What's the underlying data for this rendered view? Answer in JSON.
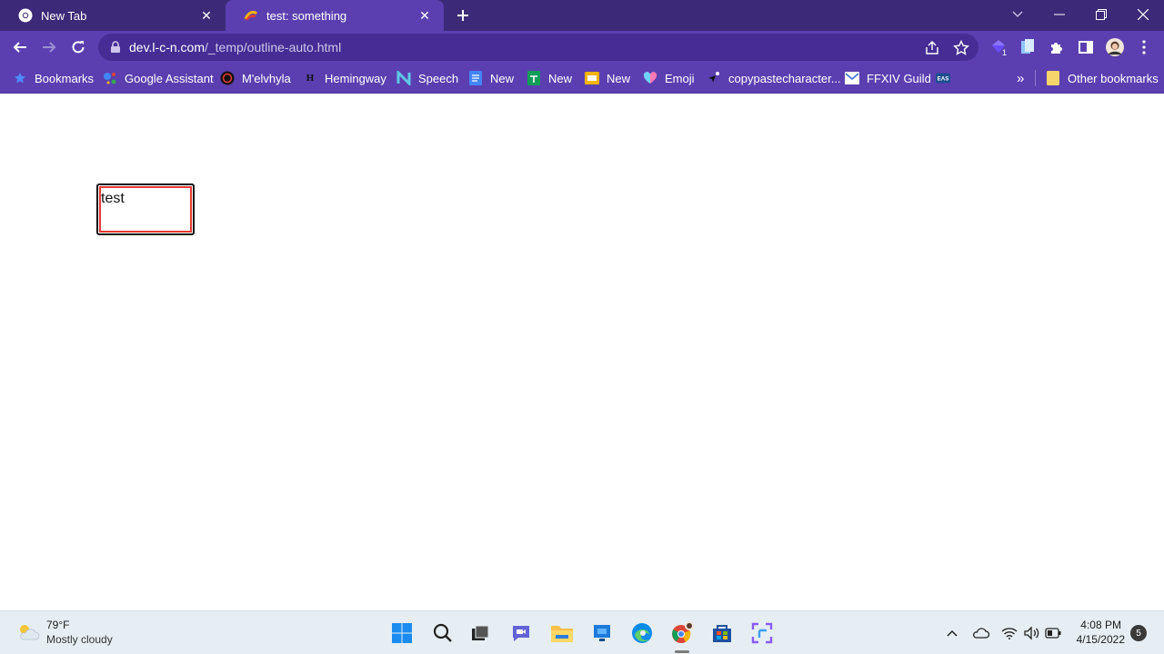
{
  "browser": {
    "tabs": [
      {
        "title": "New Tab",
        "favicon": "chrome-icon",
        "active": false
      },
      {
        "title": "test: something",
        "favicon": "page-favicon",
        "active": true
      }
    ],
    "url_host": "dev.l-c-n.com",
    "url_path": "/_temp/outline-auto.html",
    "extensions_badge": "1"
  },
  "bookmarks": [
    {
      "label": "Bookmarks",
      "icon": "star-icon"
    },
    {
      "label": "Google Assistant",
      "icon": "google-assistant-icon"
    },
    {
      "label": "M'elvhyla",
      "icon": "circle-logo-icon"
    },
    {
      "label": "Hemingway",
      "icon": "hemingway-icon"
    },
    {
      "label": "Speech",
      "icon": "speech-icon"
    },
    {
      "label": "New",
      "icon": "docs-icon"
    },
    {
      "label": "New",
      "icon": "sheets-icon"
    },
    {
      "label": "New",
      "icon": "slides-icon"
    },
    {
      "label": "Emoji",
      "icon": "heart-icon"
    },
    {
      "label": "copypastecharacter...",
      "icon": "cursor-icon"
    },
    {
      "label": "FFXIV Guild",
      "icon": "mail-icon"
    },
    {
      "label": "",
      "icon": "eas-icon"
    }
  ],
  "bookmarks_overflow": "»",
  "other_bookmarks": "Other bookmarks",
  "page": {
    "box_text": "test"
  },
  "taskbar": {
    "weather_temp": "79°F",
    "weather_desc": "Mostly cloudy",
    "time": "4:08 PM",
    "date": "4/15/2022",
    "notifications": "5"
  },
  "colors": {
    "tabstrip": "#3c2a78",
    "toolbar": "#5b3fb0",
    "outline_outer": "#111111",
    "outline_inner": "#e53935"
  }
}
